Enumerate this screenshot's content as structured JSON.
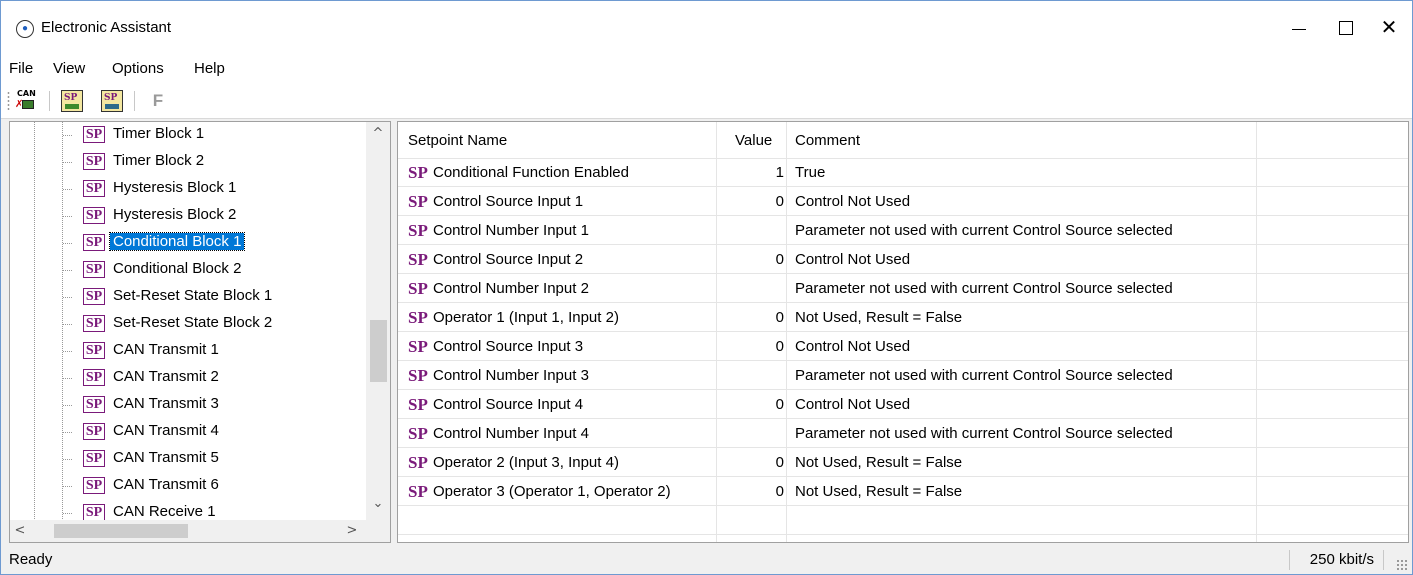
{
  "window": {
    "title": "Electronic Assistant",
    "close_glyph": "✕"
  },
  "menu": [
    "File",
    "View",
    "Options",
    "Help"
  ],
  "toolbar": {
    "can_icon_text": "CAN",
    "f_label": "F"
  },
  "tree": {
    "badge": "SP",
    "items": [
      {
        "label": "Timer Block 1"
      },
      {
        "label": "Timer Block 2"
      },
      {
        "label": "Hysteresis Block 1"
      },
      {
        "label": "Hysteresis Block 2"
      },
      {
        "label": "Conditional Block 1",
        "selected": true
      },
      {
        "label": "Conditional Block 2"
      },
      {
        "label": "Set-Reset State Block 1"
      },
      {
        "label": "Set-Reset State Block 2"
      },
      {
        "label": "CAN Transmit 1"
      },
      {
        "label": "CAN Transmit 2"
      },
      {
        "label": "CAN Transmit 3"
      },
      {
        "label": "CAN Transmit 4"
      },
      {
        "label": "CAN Transmit 5"
      },
      {
        "label": "CAN Transmit 6"
      },
      {
        "label": "CAN Receive 1"
      }
    ]
  },
  "table": {
    "columns": [
      "Setpoint Name",
      "Value",
      "Comment"
    ],
    "prefix": "SP",
    "rows": [
      {
        "name": "Conditional Function Enabled",
        "value": "1",
        "comment": "True"
      },
      {
        "name": "Control Source Input 1",
        "value": "0",
        "comment": "Control Not Used"
      },
      {
        "name": "Control Number Input 1",
        "value": "",
        "comment": "Parameter not used with current Control Source selected"
      },
      {
        "name": "Control Source Input 2",
        "value": "0",
        "comment": "Control Not Used"
      },
      {
        "name": "Control Number Input 2",
        "value": "",
        "comment": "Parameter not used with current Control Source selected"
      },
      {
        "name": "Operator 1 (Input 1, Input 2)",
        "value": "0",
        "comment": "Not Used, Result = False"
      },
      {
        "name": "Control Source Input 3",
        "value": "0",
        "comment": "Control Not Used"
      },
      {
        "name": "Control Number Input 3",
        "value": "",
        "comment": "Parameter not used with current Control Source selected"
      },
      {
        "name": "Control Source Input 4",
        "value": "0",
        "comment": "Control Not Used"
      },
      {
        "name": "Control Number Input 4",
        "value": "",
        "comment": "Parameter not used with current Control Source selected"
      },
      {
        "name": "Operator 2 (Input 3, Input 4)",
        "value": "0",
        "comment": "Not Used, Result = False"
      },
      {
        "name": "Operator 3 (Operator 1, Operator 2)",
        "value": "0",
        "comment": "Not Used, Result = False"
      }
    ]
  },
  "status": {
    "text": "Ready",
    "rate": "250 kbit/s"
  }
}
